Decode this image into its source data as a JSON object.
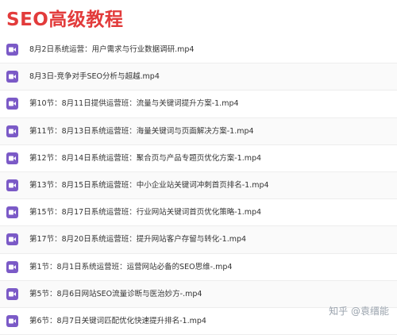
{
  "title": "SEO高级教程",
  "accent_color": "#e23b3b",
  "icon_color": "#7b5ac7",
  "icon_name": "video-file-icon",
  "files": [
    "8月2日系统运营：用户需求与行业数据调研.mp4",
    "8月3日-竞争对手SEO分析与超越.mp4",
    "第10节：8月11日提供运营班：流量与关键词提升方案-1.mp4",
    "第11节：8月13日系统运营班：海量关键词与页面解决方案-1.mp4",
    "第12节：8月14日系统运营班：聚合页与产品专题页优化方案-1.mp4",
    "第13节：8月15日系统运营班：中小企业站关键词冲刺首页排名-1.mp4",
    "第15节：8月17日系统运营班：行业网站关键词首页优化策略-1.mp4",
    "第17节：8月20日系统运营班：提升网站客户存留与转化-1.mp4",
    "第1节：8月1日系统运营班：运营网站必备的SEO思维-.mp4",
    "第5节：8月6日网站SEO流量诊断与医治妙方-.mp4",
    "第6节：8月7日关键词匹配优化快速提升排名-1.mp4"
  ],
  "watermark": "知乎 @袁缙能"
}
